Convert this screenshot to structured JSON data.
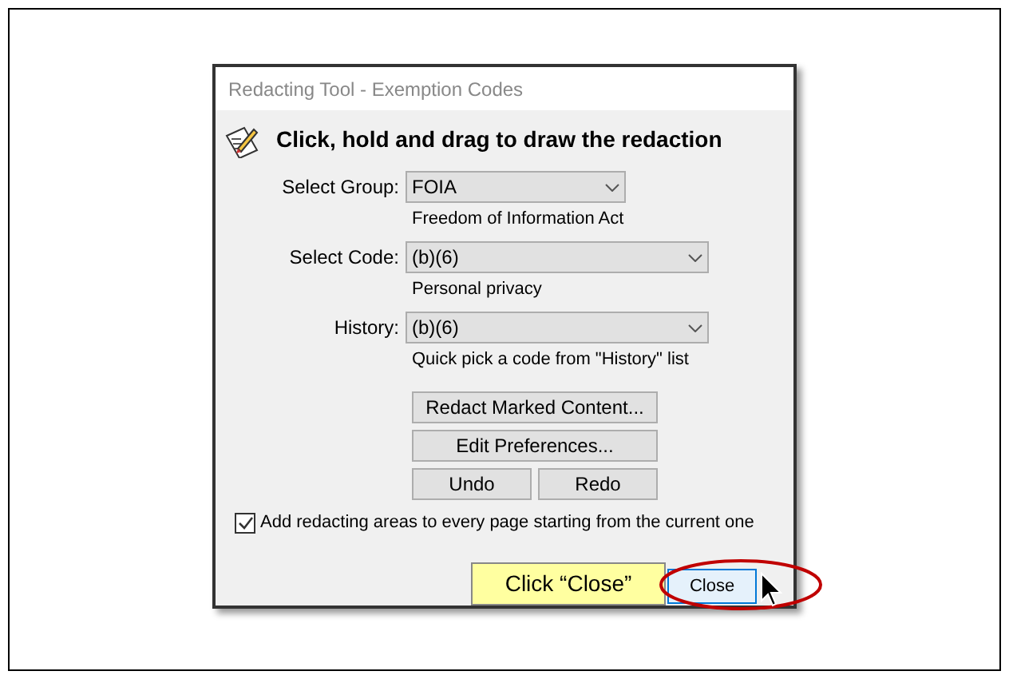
{
  "window": {
    "title": "Redacting Tool - Exemption Codes"
  },
  "heading": "Click, hold and drag to draw the redaction",
  "fields": [
    {
      "label": "Select Group:",
      "value": "FOIA",
      "hint": "Freedom of Information Act",
      "wide": false
    },
    {
      "label": "Select Code:",
      "value": "(b)(6)",
      "hint": "Personal privacy",
      "wide": true
    },
    {
      "label": "History:",
      "value": "(b)(6)",
      "hint": "Quick pick a code from \"History\" list",
      "wide": true
    }
  ],
  "buttons": [
    "Redact Marked Content...",
    "Edit Preferences...",
    "Undo",
    "Redo"
  ],
  "checkbox": {
    "label": "Add redacting areas to every page starting from the current one",
    "checked": true
  },
  "close_button": "Close",
  "callout": "Click “Close”"
}
